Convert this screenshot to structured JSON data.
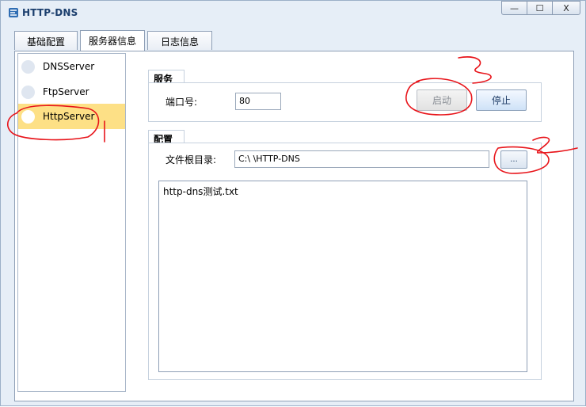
{
  "window": {
    "title": "HTTP-DNS",
    "min_label": "—",
    "max_label": "☐",
    "close_label": "X"
  },
  "tabs": [
    {
      "label": "基础配置"
    },
    {
      "label": "服务器信息"
    },
    {
      "label": "日志信息"
    }
  ],
  "sidebar": {
    "items": [
      {
        "label": "DNSServer"
      },
      {
        "label": "FtpServer"
      },
      {
        "label": "HttpServer",
        "selected": true
      }
    ]
  },
  "service": {
    "title": "服务",
    "port_label": "端口号:",
    "port_value": "80",
    "start_label": "启动",
    "stop_label": "停止"
  },
  "config": {
    "title": "配置",
    "root_label": "文件根目录:",
    "root_value": "C:\\                                                        \\HTTP-DNS",
    "browse_label": "..."
  },
  "files": [
    "http-dns测试.txt"
  ],
  "colors": {
    "accent": "#1b3e6d",
    "selected_bg": "#fde086",
    "annotation": "#e8141a"
  }
}
